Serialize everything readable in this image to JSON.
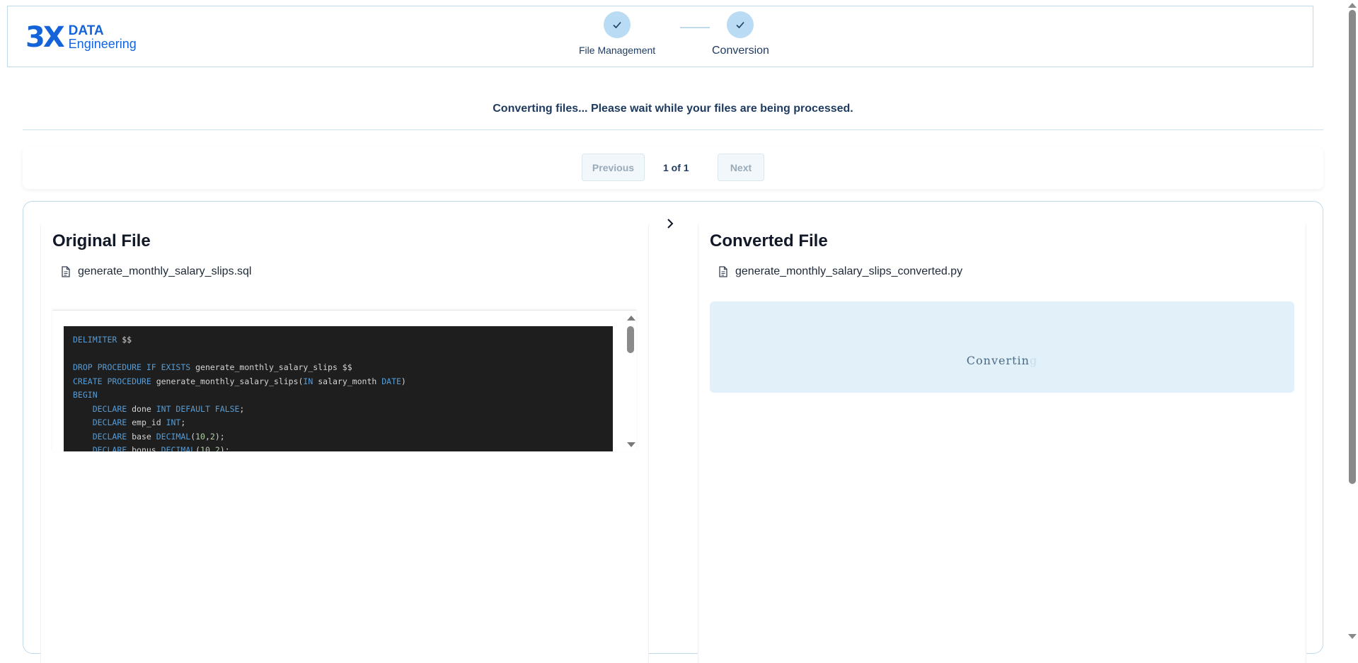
{
  "header": {
    "logo_mark": "3X",
    "logo_line1": "DATA",
    "logo_line2": "Engineering",
    "steps": [
      {
        "label": "File Management",
        "state": "complete"
      },
      {
        "label": "Conversion",
        "state": "complete"
      }
    ]
  },
  "status": {
    "message": "Converting files... Please wait while your files are being processed."
  },
  "pager": {
    "previous_label": "Previous",
    "info": "1 of 1",
    "next_label": "Next"
  },
  "original": {
    "title": "Original File",
    "file_name": "generate_monthly_salary_slips.sql"
  },
  "converted": {
    "title": "Converted File",
    "file_name": "generate_monthly_salary_slips_converted.py",
    "loading_text_main": "Convertin",
    "loading_text_fade": "g"
  },
  "icons": {
    "step_check": "check-icon",
    "file": "file-icon",
    "arrow": "chevron-right-icon"
  },
  "colors": {
    "brand": "#1463d9",
    "step_circle": "#b9dbf3",
    "code_bg": "#1e1e1e",
    "keyword": "#569cd6",
    "loading_bg": "#e2f0f9"
  }
}
